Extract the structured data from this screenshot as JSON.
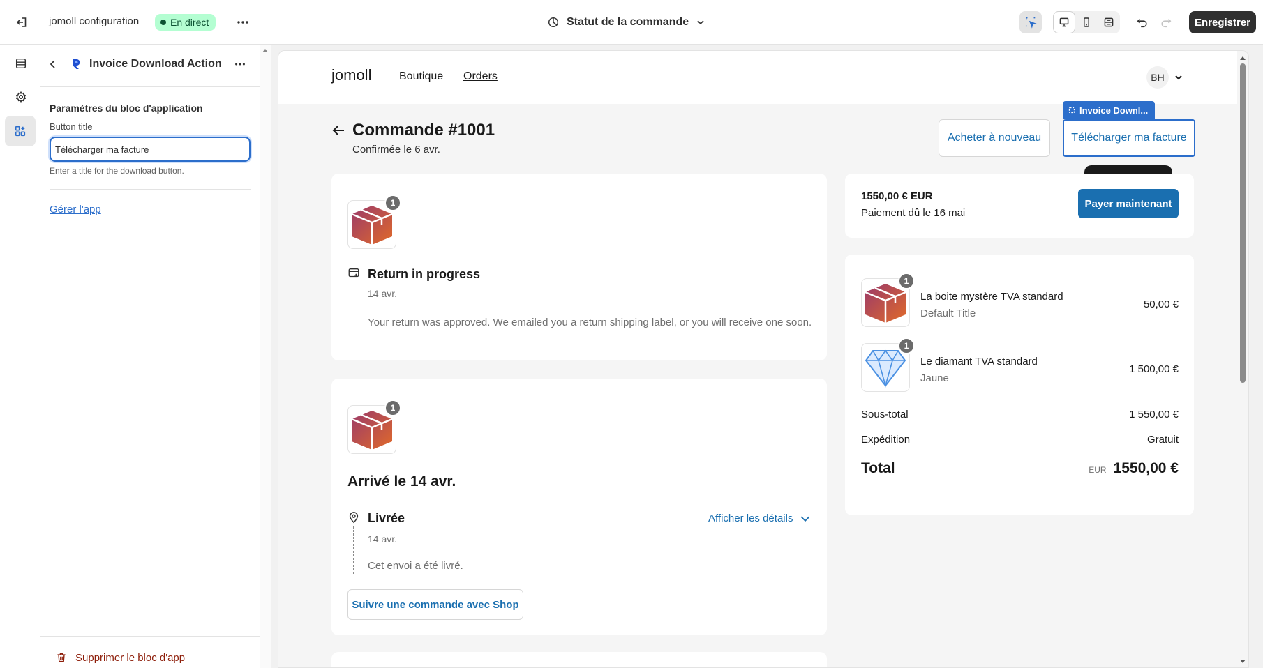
{
  "topbar": {
    "store_name": "jomoll configuration",
    "live_badge": "En direct",
    "template_selector": "Statut de la commande",
    "save_label": "Enregistrer"
  },
  "sidepanel": {
    "title": "Invoice Download Action",
    "section_title": "Paramètres du bloc d'application",
    "field_label": "Button title",
    "field_value": "Télécharger ma facture",
    "field_help": "Enter a title for the download button.",
    "manage_app_link": "Gérer l'app",
    "delete_label": "Supprimer le bloc d'app"
  },
  "store": {
    "logo": "jomoll",
    "nav": [
      "Boutique",
      "Orders"
    ],
    "avatar": "BH"
  },
  "order": {
    "title": "Commande #1001",
    "subtitle": "Confirmée le 6 avr.",
    "buy_again": "Acheter à nouveau",
    "download_invoice": "Télécharger ma facture",
    "block_tag": "Invoice Downl..."
  },
  "return_card": {
    "badge": "1",
    "title": "Return in progress",
    "date": "14 avr.",
    "message": "Your return was approved. We emailed you a return shipping label, or you will receive one soon."
  },
  "delivery_card": {
    "badge": "1",
    "title": "Arrivé le 14 avr.",
    "status": "Livrée",
    "details_link": "Afficher les détails",
    "date": "14 avr.",
    "message": "Cet envoi a été livré.",
    "track_button": "Suivre une commande avec Shop"
  },
  "payment_card": {
    "amount": "1550,00 € EUR",
    "due": "Paiement dû le 16 mai",
    "pay_button": "Payer maintenant"
  },
  "summary": {
    "items": [
      {
        "badge": "1",
        "name": "La boite mystère TVA standard",
        "variant": "Default Title",
        "price": "50,00 €"
      },
      {
        "badge": "1",
        "name": "Le diamant TVA standard",
        "variant": "Jaune",
        "price": "1 500,00 €"
      }
    ],
    "subtotal_label": "Sous-total",
    "subtotal_value": "1 550,00 €",
    "shipping_label": "Expédition",
    "shipping_value": "Gratuit",
    "total_label": "Total",
    "total_currency": "EUR",
    "total_value": "1550,00 €"
  }
}
